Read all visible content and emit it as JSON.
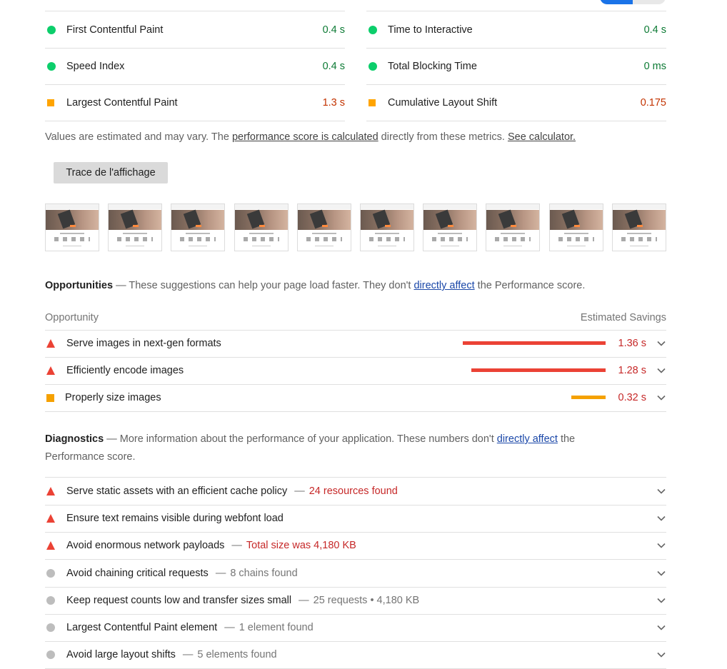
{
  "metrics": {
    "left": [
      {
        "label": "First Contentful Paint",
        "value": "0.4 s",
        "status": "good"
      },
      {
        "label": "Speed Index",
        "value": "0.4 s",
        "status": "good"
      },
      {
        "label": "Largest Contentful Paint",
        "value": "1.3 s",
        "status": "average"
      }
    ],
    "right": [
      {
        "label": "Time to Interactive",
        "value": "0.4 s",
        "status": "good"
      },
      {
        "label": "Total Blocking Time",
        "value": "0 ms",
        "status": "good"
      },
      {
        "label": "Cumulative Layout Shift",
        "value": "0.175",
        "status": "average"
      }
    ]
  },
  "note": {
    "prefix": "Values are estimated and may vary. The ",
    "link1": "performance score is calculated",
    "middle": " directly from these metrics. ",
    "link2": "See calculator."
  },
  "trace_button": "Trace de l'affichage",
  "filmstrip_frames": 10,
  "opportunities": {
    "title": "Opportunities",
    "desc_prefix": " — These suggestions can help your page load faster. They don't ",
    "desc_link": "directly affect",
    "desc_suffix": " the Performance score.",
    "col_left": "Opportunity",
    "col_right": "Estimated Savings",
    "items": [
      {
        "label": "Serve images in next-gen formats",
        "value": "1.36 s",
        "fraction": 1.0,
        "severity": "fail",
        "bar_color": "#eb4235"
      },
      {
        "label": "Efficiently encode images",
        "value": "1.28 s",
        "fraction": 0.94,
        "severity": "fail",
        "bar_color": "#eb4235"
      },
      {
        "label": "Properly size images",
        "value": "0.32 s",
        "fraction": 0.24,
        "severity": "average",
        "bar_color": "#f5a100"
      }
    ]
  },
  "diagnostics": {
    "title": "Diagnostics",
    "desc_prefix": " — More information about the performance of your application. These numbers don't ",
    "desc_link": "directly affect",
    "desc_suffix": " the",
    "desc_line2": "Performance score.",
    "items": [
      {
        "label": "Serve static assets with an efficient cache policy",
        "detail": "24 resources found",
        "severity": "fail"
      },
      {
        "label": "Ensure text remains visible during webfont load",
        "detail": "",
        "severity": "fail"
      },
      {
        "label": "Avoid enormous network payloads",
        "detail": "Total size was 4,180 KB",
        "severity": "fail"
      },
      {
        "label": "Avoid chaining critical requests",
        "detail": "8 chains found",
        "severity": "info"
      },
      {
        "label": "Keep request counts low and transfer sizes small",
        "detail": "25 requests • 4,180 KB",
        "severity": "info"
      },
      {
        "label": "Largest Contentful Paint element",
        "detail": "1 element found",
        "severity": "info"
      },
      {
        "label": "Avoid large layout shifts",
        "detail": "5 elements found",
        "severity": "info"
      }
    ]
  },
  "colors": {
    "good": "#0cce6b",
    "average": "#ffa400",
    "fail": "#eb4235",
    "info": "#bdbdbd",
    "link": "#1a47a8"
  }
}
